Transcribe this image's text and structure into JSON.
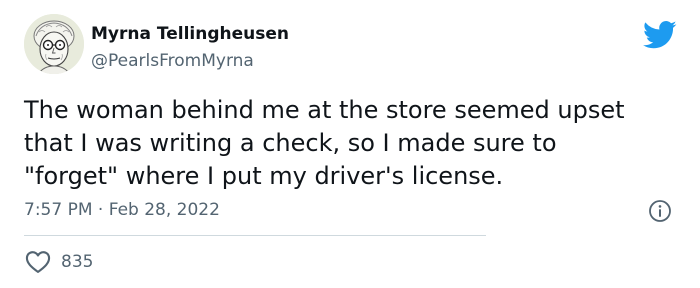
{
  "author": {
    "display_name": "Myrna Tellingheusen",
    "handle": "@PearlsFromMyrna"
  },
  "tweet": {
    "text": "The woman behind me at the store seemed upset\nthat I was writing a check, so I made sure to\n\"forget\" where I put my driver's license.",
    "time": "7:57 PM",
    "separator": "·",
    "date": "Feb 28, 2022"
  },
  "engagement": {
    "likes": "835"
  },
  "icons": {
    "platform": "twitter-bird-icon",
    "info": "info-icon",
    "like": "heart-icon"
  },
  "colors": {
    "brand_blue": "#1d9bf0",
    "text_primary": "#0f1419",
    "text_secondary": "#536471",
    "divider": "#cfd9de"
  }
}
